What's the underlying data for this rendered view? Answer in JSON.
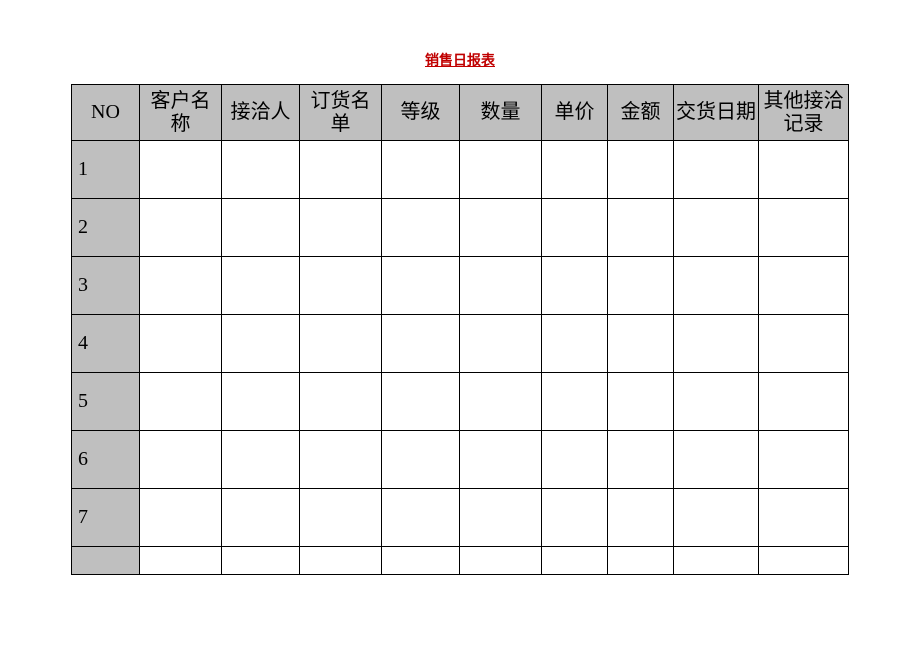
{
  "title": "销售日报表",
  "headers": {
    "no": "NO",
    "customer": "客户名称",
    "contact": "接洽人",
    "order": "订货名单",
    "grade": "等级",
    "qty": "数量",
    "price": "单价",
    "amount": "金额",
    "delivery": "交货日期",
    "other": "其他接洽记录"
  },
  "rows": [
    {
      "no": "1",
      "customer": "",
      "contact": "",
      "order": "",
      "grade": "",
      "qty": "",
      "price": "",
      "amount": "",
      "delivery": "",
      "other": ""
    },
    {
      "no": "2",
      "customer": "",
      "contact": "",
      "order": "",
      "grade": "",
      "qty": "",
      "price": "",
      "amount": "",
      "delivery": "",
      "other": ""
    },
    {
      "no": "3",
      "customer": "",
      "contact": "",
      "order": "",
      "grade": "",
      "qty": "",
      "price": "",
      "amount": "",
      "delivery": "",
      "other": ""
    },
    {
      "no": "4",
      "customer": "",
      "contact": "",
      "order": "",
      "grade": "",
      "qty": "",
      "price": "",
      "amount": "",
      "delivery": "",
      "other": ""
    },
    {
      "no": "5",
      "customer": "",
      "contact": "",
      "order": "",
      "grade": "",
      "qty": "",
      "price": "",
      "amount": "",
      "delivery": "",
      "other": ""
    },
    {
      "no": "6",
      "customer": "",
      "contact": "",
      "order": "",
      "grade": "",
      "qty": "",
      "price": "",
      "amount": "",
      "delivery": "",
      "other": ""
    },
    {
      "no": "7",
      "customer": "",
      "contact": "",
      "order": "",
      "grade": "",
      "qty": "",
      "price": "",
      "amount": "",
      "delivery": "",
      "other": ""
    },
    {
      "no": "",
      "customer": "",
      "contact": "",
      "order": "",
      "grade": "",
      "qty": "",
      "price": "",
      "amount": "",
      "delivery": "",
      "other": ""
    }
  ]
}
